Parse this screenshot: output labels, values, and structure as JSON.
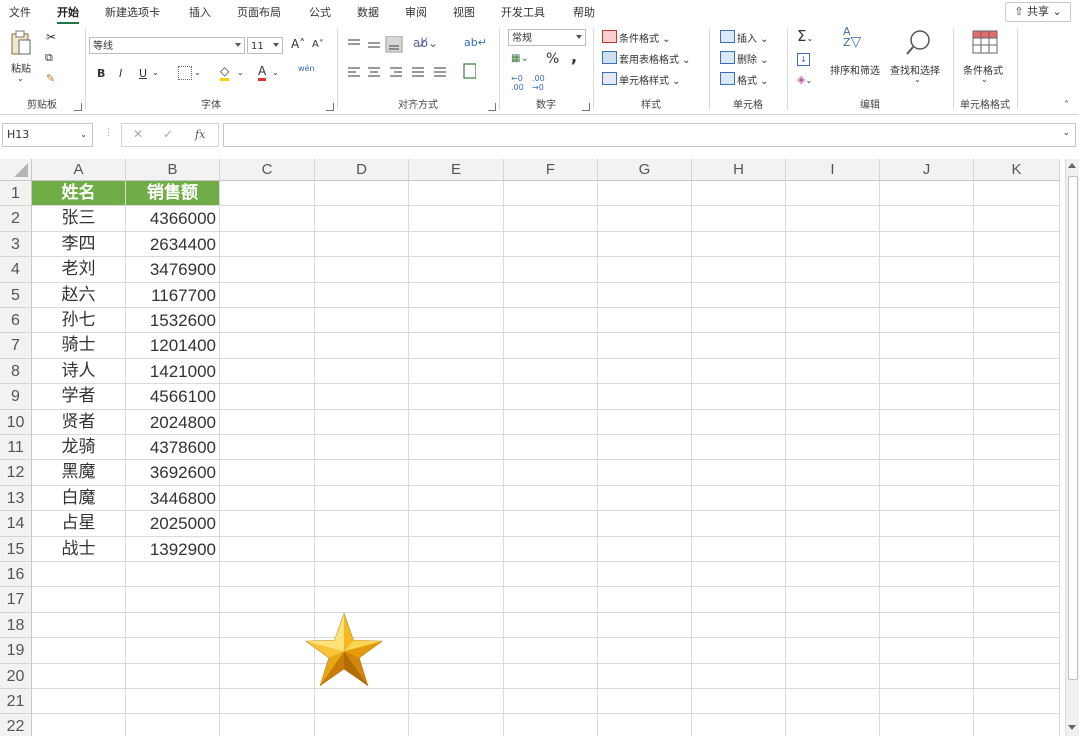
{
  "tabs": [
    "文件",
    "开始",
    "新建选项卡",
    "插入",
    "页面布局",
    "公式",
    "数据",
    "审阅",
    "视图",
    "开发工具",
    "帮助"
  ],
  "active_tab": "开始",
  "share_label": "共享",
  "ribbon": {
    "clipboard": {
      "paste": "粘贴",
      "label": "剪贴板"
    },
    "font": {
      "family": "等线",
      "size": "11",
      "label": "字体",
      "bold": "B",
      "italic": "I",
      "underline": "U",
      "grow": "A",
      "shrink": "A",
      "phonetic": "wén"
    },
    "align": {
      "label": "对齐方式"
    },
    "number": {
      "format": "常规",
      "percent": "%",
      "comma": ",",
      "label": "数字"
    },
    "styles": {
      "cond_format": "条件格式",
      "table_format": "套用表格格式",
      "cell_style": "单元格样式",
      "label": "样式"
    },
    "cells": {
      "insert": "插入",
      "delete": "删除",
      "format": "格式",
      "label": "单元格"
    },
    "editing": {
      "sort_filter": "排序和筛选",
      "find_select": "查找和选择",
      "label": "编辑"
    },
    "cond_group": {
      "button": "条件格式",
      "label": "单元格格式"
    }
  },
  "formula_bar": {
    "name_box": "H13",
    "fx": "fx",
    "content": ""
  },
  "columns": [
    "A",
    "B",
    "C",
    "D",
    "E",
    "F",
    "G",
    "H",
    "I",
    "J",
    "K"
  ],
  "row_numbers": [
    "1",
    "2",
    "3",
    "4",
    "5",
    "6",
    "7",
    "8",
    "9",
    "10",
    "11",
    "12",
    "13",
    "14",
    "15",
    "16",
    "17",
    "18",
    "19",
    "20",
    "21",
    "22"
  ],
  "table": {
    "headers": [
      "姓名",
      "销售额"
    ],
    "rows": [
      [
        "张三",
        "4366000"
      ],
      [
        "李四",
        "2634400"
      ],
      [
        "老刘",
        "3476900"
      ],
      [
        "赵六",
        "1167700"
      ],
      [
        "孙七",
        "1532600"
      ],
      [
        "骑士",
        "1201400"
      ],
      [
        "诗人",
        "1421000"
      ],
      [
        "学者",
        "4566100"
      ],
      [
        "贤者",
        "2024800"
      ],
      [
        "龙骑",
        "4378600"
      ],
      [
        "黑魔",
        "3692600"
      ],
      [
        "白魔",
        "3446800"
      ],
      [
        "占星",
        "2025000"
      ],
      [
        "战士",
        "1392900"
      ]
    ]
  },
  "colors": {
    "header_fill": "#70ad47",
    "accent": "#217346",
    "star": "#f2b818"
  },
  "icons": [
    "paste-icon",
    "cut-icon",
    "copy-icon",
    "format-painter-icon",
    "autosum-icon",
    "sort-filter-icon",
    "find-icon",
    "star-shape"
  ]
}
